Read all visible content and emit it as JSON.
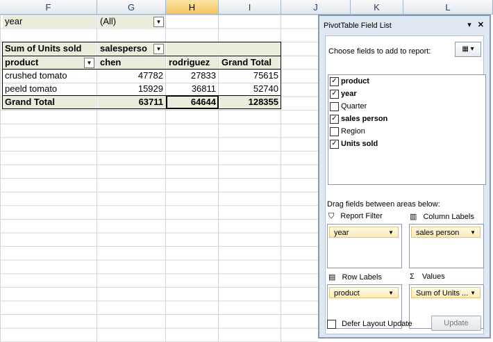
{
  "columns": [
    "F",
    "G",
    "H",
    "I",
    "J",
    "K",
    "L"
  ],
  "filter": {
    "label": "year",
    "value": "(All)"
  },
  "pivot": {
    "corner": "Sum of Units sold",
    "col_field": "salesperso",
    "row_field": "product",
    "col_headers": [
      "chen",
      "rodriguez",
      "Grand Total"
    ],
    "rows": [
      {
        "label": "crushed tomato",
        "values": [
          "47782",
          "27833",
          "75615"
        ]
      },
      {
        "label": "peeld tomato",
        "values": [
          "15929",
          "36811",
          "52740"
        ]
      }
    ],
    "total": {
      "label": "Grand Total",
      "values": [
        "63711",
        "64644",
        "128355"
      ]
    }
  },
  "panel": {
    "title": "PivotTable Field List",
    "choose_label": "Choose fields to add to report:",
    "fields": [
      {
        "name": "product",
        "checked": true
      },
      {
        "name": "year",
        "checked": true
      },
      {
        "name": "Quarter",
        "checked": false
      },
      {
        "name": "sales person",
        "checked": true
      },
      {
        "name": "Region",
        "checked": false
      },
      {
        "name": "Units sold",
        "checked": true
      }
    ],
    "drag_label": "Drag fields between areas below:",
    "report_filter": {
      "title": "Report Filter",
      "chip": "year"
    },
    "column_labels": {
      "title": "Column Labels",
      "chip": "sales person"
    },
    "row_labels": {
      "title": "Row Labels",
      "chip": "product"
    },
    "values": {
      "title": "Values",
      "chip": "Sum of Units ..."
    },
    "defer_label": "Defer Layout Update",
    "update_label": "Update"
  }
}
